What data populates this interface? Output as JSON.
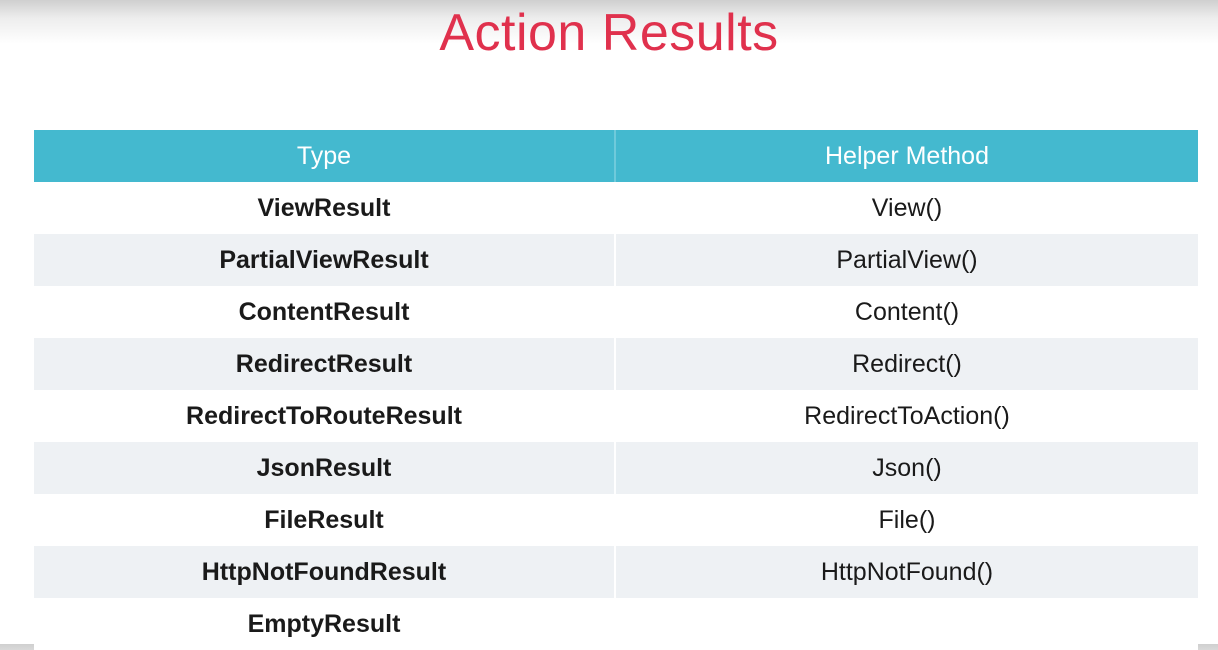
{
  "title": "Action Results",
  "colors": {
    "title": "#e0314d",
    "header_background": "#44b9cf",
    "header_text": "#ffffff",
    "stripe": "#eef1f4"
  },
  "table": {
    "headers": [
      "Type",
      "Helper Method"
    ],
    "rows": [
      [
        "ViewResult",
        "View()"
      ],
      [
        "PartialViewResult",
        "PartialView()"
      ],
      [
        "ContentResult",
        "Content()"
      ],
      [
        "RedirectResult",
        "Redirect()"
      ],
      [
        "RedirectToRouteResult",
        "RedirectToAction()"
      ],
      [
        "JsonResult",
        "Json()"
      ],
      [
        "FileResult",
        "File()"
      ],
      [
        "HttpNotFoundResult",
        "HttpNotFound()"
      ],
      [
        "EmptyResult",
        ""
      ]
    ]
  }
}
